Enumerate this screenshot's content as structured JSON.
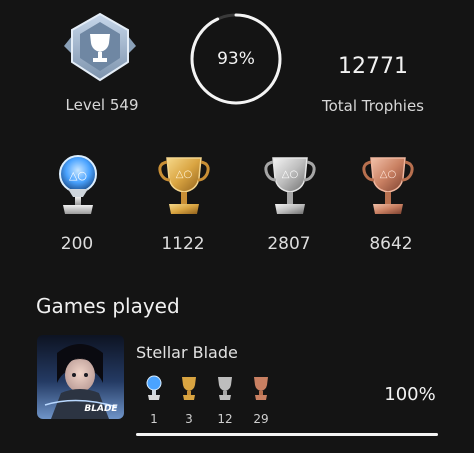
{
  "profile": {
    "level_label": "Level 549",
    "completion_percent_label": "93%",
    "completion_fraction": 0.93,
    "total_trophies_count": "12771",
    "total_trophies_label": "Total Trophies"
  },
  "trophies": [
    {
      "type": "platinum",
      "count": "200",
      "color": "#4aa3ff"
    },
    {
      "type": "gold",
      "count": "1122",
      "color": "#d9a441"
    },
    {
      "type": "silver",
      "count": "2807",
      "color": "#bdbdbd"
    },
    {
      "type": "bronze",
      "count": "8642",
      "color": "#c98062"
    }
  ],
  "games_section": {
    "title": "Games played",
    "games": [
      {
        "title": "Stellar Blade",
        "cover_text": "BLADE",
        "progress_label": "100%",
        "progress_fraction": 1.0,
        "trophies": [
          {
            "type": "platinum",
            "count": "1"
          },
          {
            "type": "gold",
            "count": "3"
          },
          {
            "type": "silver",
            "count": "12"
          },
          {
            "type": "bronze",
            "count": "29"
          }
        ]
      }
    ]
  },
  "icons": {
    "level_badge": "level-badge-icon",
    "trophy": "trophy-icon"
  }
}
